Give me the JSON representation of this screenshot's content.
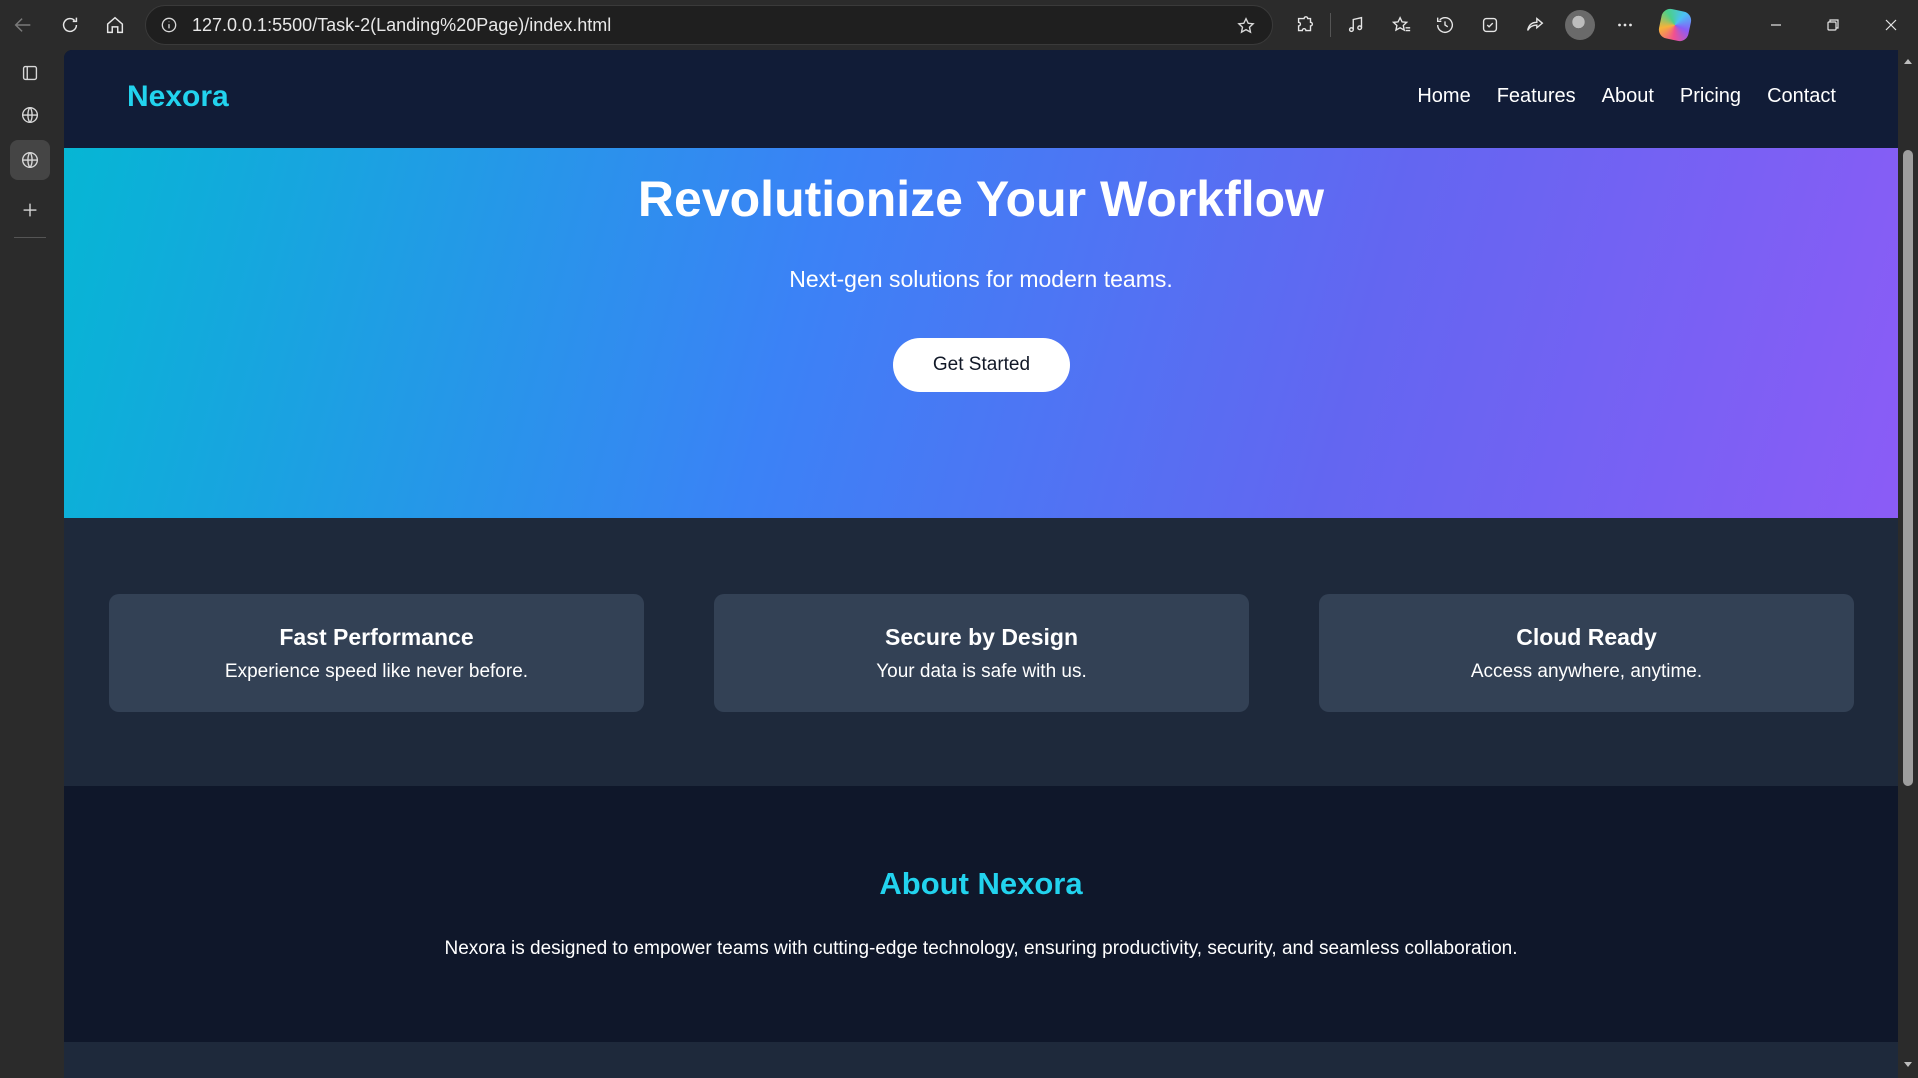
{
  "browser": {
    "url": "127.0.0.1:5500/Task-2(Landing%20Page)/index.html"
  },
  "nav": {
    "brand": "Nexora",
    "links": [
      "Home",
      "Features",
      "About",
      "Pricing",
      "Contact"
    ]
  },
  "hero": {
    "title": "Revolutionize Your Workflow",
    "subtitle": "Next-gen solutions for modern teams.",
    "cta_label": "Get Started"
  },
  "features": [
    {
      "title": "Fast Performance",
      "text": "Experience speed like never before."
    },
    {
      "title": "Secure by Design",
      "text": "Your data is safe with us."
    },
    {
      "title": "Cloud Ready",
      "text": "Access anywhere, anytime."
    }
  ],
  "about": {
    "title": "About Nexora",
    "text": "Nexora is designed to empower teams with cutting-edge technology, ensuring productivity, security, and seamless collaboration."
  },
  "colors": {
    "accent": "#22d3ee",
    "nav_bg": "#111c37",
    "hero_start": "#06b6d4",
    "hero_end": "#8b5cf6",
    "card_bg": "#334155"
  },
  "icons": {
    "toolbar": [
      "back-arrow-icon",
      "reload-icon",
      "home-icon",
      "site-info-icon",
      "favorite-star-icon",
      "extensions-icon",
      "read-aloud-icon",
      "favorites-icon",
      "history-icon",
      "collections-icon",
      "share-icon",
      "profile-avatar-icon",
      "more-options-icon",
      "copilot-icon"
    ],
    "sidebar": [
      "tab-actions-icon",
      "globe-icon",
      "globe-active-icon",
      "add-icon"
    ]
  }
}
